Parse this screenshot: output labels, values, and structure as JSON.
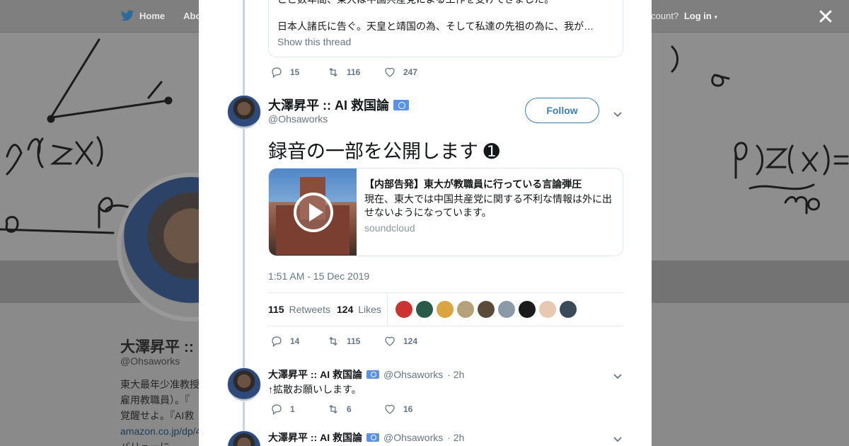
{
  "background": {
    "nav": {
      "home_label": "Home",
      "about_label": "Abo",
      "account_prompt": "ccount?",
      "login_label": "Log in"
    },
    "profile": {
      "name": "大澤昇平 :: ",
      "handle": "@Ohsaworks",
      "bio_lines": [
        "東大最年少准教授",
        "雇用教職員）。『",
        "覚醒せよ。『AI救"
      ],
      "bio_link": "amazon.co.jp/dp/4",
      "bio_tail": "バリューに"
    }
  },
  "modal": {
    "quoted": {
      "line1": "ここ数年間、東大は中国共産党による工作を受けてきました。",
      "line2": "日本人諸氏に告ぐ。天皇と靖国の為、そして私達の先祖の為に、我が…",
      "show_thread": "Show this thread"
    },
    "prev_actions": {
      "reply_count": "15",
      "retweet_count": "116",
      "like_count": "247"
    },
    "tweet": {
      "name": "大澤昇平 :: AI 救国論",
      "handle": "@Ohsaworks",
      "follow_label": "Follow",
      "text": "録音の一部を公開します ➊",
      "card": {
        "title": "【内部告発】東大が教職員に行っている言論弾圧",
        "description": "現在、東大では中国共産党に関する不利な情報は外に出せないようになっています。",
        "site": "soundcloud"
      },
      "timestamp": "1:51 AM - 15 Dec 2019",
      "retweets_count": "115",
      "retweets_label": "Retweets",
      "likes_count": "124",
      "likes_label": "Likes",
      "likers_colors": [
        "#c33",
        "#2a5a4a",
        "#d9a441",
        "#b5a27a",
        "#5a4a3a",
        "#8a9aa6",
        "#1a1a1a",
        "#e8c8b0",
        "#3a4a5a"
      ],
      "actions": {
        "reply_count": "14",
        "retweet_count": "115",
        "like_count": "124"
      }
    },
    "replies": [
      {
        "name": "大澤昇平 :: AI 救国論",
        "handle": "@Ohsaworks",
        "time": "· 2h",
        "text": "↑拡散お願いします。",
        "reply_count": "1",
        "retweet_count": "6",
        "like_count": "16"
      },
      {
        "name": "大澤昇平 :: AI 救国論",
        "handle": "@Ohsaworks",
        "time": "· 2h"
      }
    ]
  },
  "close_label": "✕",
  "colors": {
    "accent": "#1da1f2",
    "follow": "#3c7fb0",
    "muted": "#657786",
    "thread_line": "#c4d5e6"
  }
}
